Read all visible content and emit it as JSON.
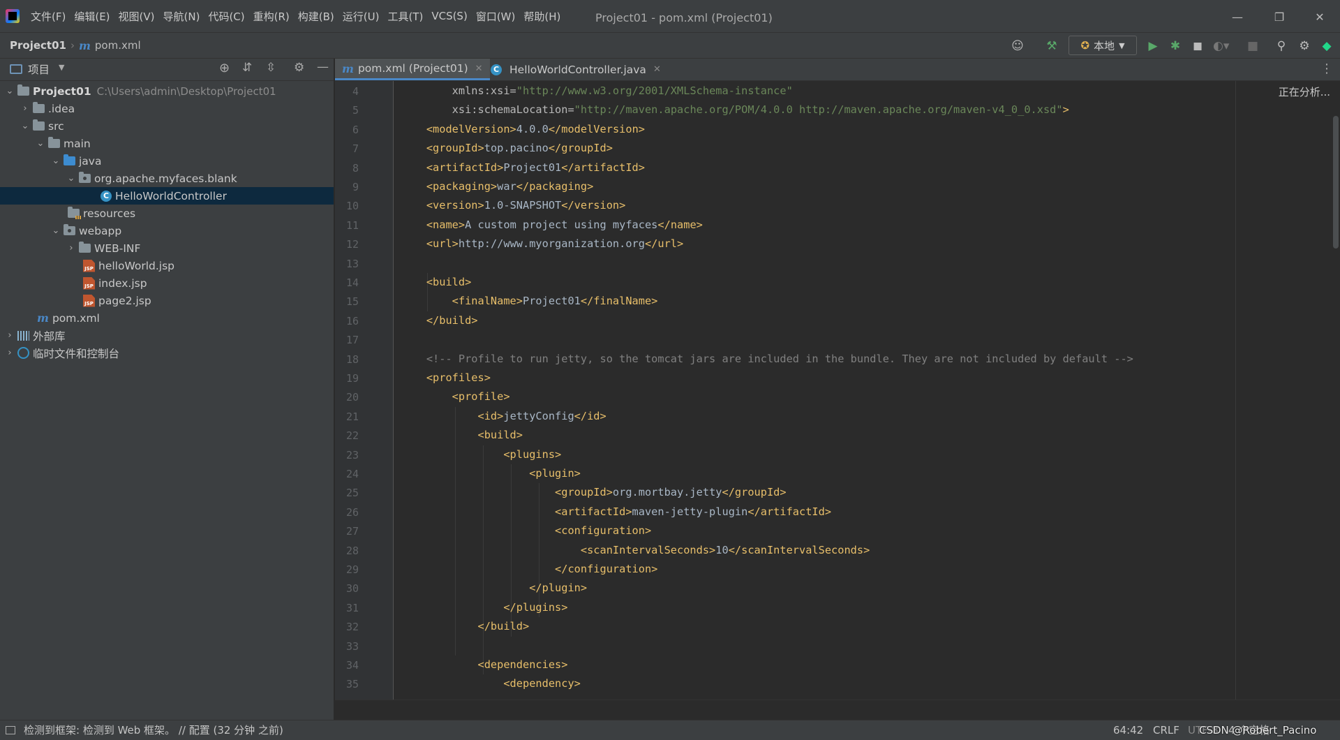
{
  "menu": [
    "文件(F)",
    "编辑(E)",
    "视图(V)",
    "导航(N)",
    "代码(C)",
    "重构(R)",
    "构建(B)",
    "运行(U)",
    "工具(T)",
    "VCS(S)",
    "窗口(W)",
    "帮助(H)"
  ],
  "window_title": "Project01 - pom.xml (Project01)",
  "breadcrumb": {
    "project": "Project01",
    "file": "pom.xml"
  },
  "run_config": "本地",
  "project_panel": {
    "title": "项目",
    "tree": [
      {
        "label": "Project01",
        "path": "C:\\Users\\admin\\Desktop\\Project01"
      },
      {
        "label": ".idea"
      },
      {
        "label": "src"
      },
      {
        "label": "main"
      },
      {
        "label": "java"
      },
      {
        "label": "org.apache.myfaces.blank"
      },
      {
        "label": "HelloWorldController"
      },
      {
        "label": "resources"
      },
      {
        "label": "webapp"
      },
      {
        "label": "WEB-INF"
      },
      {
        "label": "helloWorld.jsp"
      },
      {
        "label": "index.jsp"
      },
      {
        "label": "page2.jsp"
      },
      {
        "label": "pom.xml"
      },
      {
        "label": "外部库"
      },
      {
        "label": "临时文件和控制台"
      }
    ]
  },
  "tabs": [
    {
      "label": "pom.xml (Project01)",
      "active": true
    },
    {
      "label": "HelloWorldController.java",
      "active": false
    }
  ],
  "analyzing": "正在分析...",
  "code_lines": [
    {
      "n": "4",
      "parts": [
        [
          "attr",
          "        xmlns:xsi="
        ],
        [
          "val",
          "\"http://www.w3.org/2001/XMLSchema-instance\""
        ]
      ]
    },
    {
      "n": "5",
      "parts": [
        [
          "attr",
          "        xsi:schemaLocation="
        ],
        [
          "val",
          "\"http://maven.apache.org/POM/4.0.0 http://maven.apache.org/maven-v4_0_0.xsd\""
        ],
        [
          "tag",
          ">"
        ]
      ]
    },
    {
      "n": "6",
      "parts": [
        [
          "tag",
          "    <modelVersion>"
        ],
        [
          "txt",
          "4.0.0"
        ],
        [
          "tag",
          "</modelVersion>"
        ]
      ]
    },
    {
      "n": "7",
      "parts": [
        [
          "tag",
          "    <groupId>"
        ],
        [
          "txt",
          "top.pacino"
        ],
        [
          "tag",
          "</groupId>"
        ]
      ]
    },
    {
      "n": "8",
      "parts": [
        [
          "tag",
          "    <artifactId>"
        ],
        [
          "txt",
          "Project01"
        ],
        [
          "tag",
          "</artifactId>"
        ]
      ]
    },
    {
      "n": "9",
      "parts": [
        [
          "tag",
          "    <packaging>"
        ],
        [
          "txt",
          "war"
        ],
        [
          "tag",
          "</packaging>"
        ]
      ]
    },
    {
      "n": "10",
      "parts": [
        [
          "tag",
          "    <version>"
        ],
        [
          "txt",
          "1.0-SNAPSHOT"
        ],
        [
          "tag",
          "</version>"
        ]
      ]
    },
    {
      "n": "11",
      "parts": [
        [
          "tag",
          "    <name>"
        ],
        [
          "txt",
          "A custom project using myfaces"
        ],
        [
          "tag",
          "</name>"
        ]
      ]
    },
    {
      "n": "12",
      "parts": [
        [
          "tag",
          "    <url>"
        ],
        [
          "txt",
          "http://www.myorganization.org"
        ],
        [
          "tag",
          "</url>"
        ]
      ]
    },
    {
      "n": "13",
      "parts": []
    },
    {
      "n": "14",
      "parts": [
        [
          "tag",
          "    <build>"
        ]
      ]
    },
    {
      "n": "15",
      "parts": [
        [
          "tag",
          "        <finalName>"
        ],
        [
          "txt",
          "Project01"
        ],
        [
          "tag",
          "</finalName>"
        ]
      ]
    },
    {
      "n": "16",
      "parts": [
        [
          "tag",
          "    </build>"
        ]
      ]
    },
    {
      "n": "17",
      "parts": []
    },
    {
      "n": "18",
      "parts": [
        [
          "cmt",
          "    <!-- Profile to run jetty, so the tomcat jars are included in the bundle. They are not included by default -->"
        ]
      ]
    },
    {
      "n": "19",
      "parts": [
        [
          "tag",
          "    <profiles>"
        ]
      ]
    },
    {
      "n": "20",
      "parts": [
        [
          "tag",
          "        <profile>"
        ]
      ]
    },
    {
      "n": "21",
      "parts": [
        [
          "tag",
          "            <id>"
        ],
        [
          "txt",
          "jettyConfig"
        ],
        [
          "tag",
          "</id>"
        ]
      ]
    },
    {
      "n": "22",
      "parts": [
        [
          "tag",
          "            <build>"
        ]
      ]
    },
    {
      "n": "23",
      "parts": [
        [
          "tag",
          "                <plugins>"
        ]
      ]
    },
    {
      "n": "24",
      "parts": [
        [
          "tag",
          "                    <plugin>"
        ]
      ]
    },
    {
      "n": "25",
      "parts": [
        [
          "tag",
          "                        <groupId>"
        ],
        [
          "txt",
          "org.mortbay.jetty"
        ],
        [
          "tag",
          "</groupId>"
        ]
      ]
    },
    {
      "n": "26",
      "parts": [
        [
          "tag",
          "                        <artifactId>"
        ],
        [
          "txt",
          "maven-jetty-plugin"
        ],
        [
          "tag",
          "</artifactId>"
        ]
      ]
    },
    {
      "n": "27",
      "parts": [
        [
          "tag",
          "                        <configuration>"
        ]
      ]
    },
    {
      "n": "28",
      "parts": [
        [
          "tag",
          "                            <scanIntervalSeconds>"
        ],
        [
          "txt",
          "10"
        ],
        [
          "tag",
          "</scanIntervalSeconds>"
        ]
      ]
    },
    {
      "n": "29",
      "parts": [
        [
          "tag",
          "                        </configuration>"
        ]
      ]
    },
    {
      "n": "30",
      "parts": [
        [
          "tag",
          "                    </plugin>"
        ]
      ]
    },
    {
      "n": "31",
      "parts": [
        [
          "tag",
          "                </plugins>"
        ]
      ]
    },
    {
      "n": "32",
      "parts": [
        [
          "tag",
          "            </build>"
        ]
      ]
    },
    {
      "n": "33",
      "parts": []
    },
    {
      "n": "34",
      "parts": [
        [
          "tag",
          "            <dependencies>"
        ]
      ]
    },
    {
      "n": "35",
      "parts": [
        [
          "tag",
          "                <dependency>"
        ]
      ]
    }
  ],
  "status": {
    "message": "检测到框架: 检测到 Web 框架。 // 配置 (32 分钟 之前)",
    "position": "64:42",
    "line_sep": "CRLF",
    "encoding": "UTF-8",
    "indent": "4 个空格",
    "watermark": "CSDN @Robert_Pacino"
  }
}
